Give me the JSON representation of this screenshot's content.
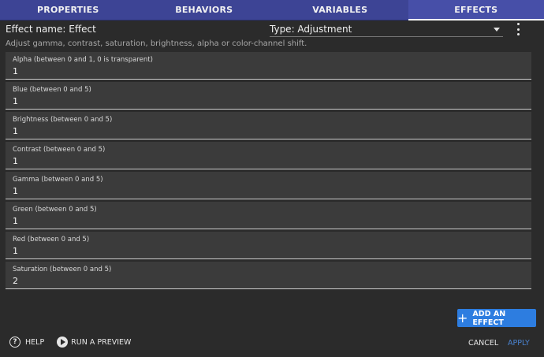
{
  "tabs": [
    {
      "label": "PROPERTIES"
    },
    {
      "label": "BEHAVIORS"
    },
    {
      "label": "VARIABLES"
    },
    {
      "label": "EFFECTS"
    }
  ],
  "active_tab": "EFFECTS",
  "effect": {
    "name_text": "Effect name: Effect",
    "type_text": "Type: Adjustment",
    "description": "Adjust gamma, contrast, saturation, brightness, alpha or color-channel shift."
  },
  "fields": [
    {
      "label": "Alpha (between 0 and 1, 0 is transparent)",
      "value": "1"
    },
    {
      "label": "Blue (between 0 and 5)",
      "value": "1"
    },
    {
      "label": "Brightness (between 0 and 5)",
      "value": "1"
    },
    {
      "label": "Contrast (between 0 and 5)",
      "value": "1"
    },
    {
      "label": "Gamma (between 0 and 5)",
      "value": "1"
    },
    {
      "label": "Green (between 0 and 5)",
      "value": "1"
    },
    {
      "label": "Red (between 0 and 5)",
      "value": "1"
    },
    {
      "label": "Saturation (between 0 and 5)",
      "value": "2"
    }
  ],
  "actions": {
    "add_effect": "ADD AN EFFECT",
    "help": "HELP",
    "run_preview": "RUN A PREVIEW",
    "cancel": "CANCEL",
    "apply": "APPLY"
  },
  "icons": {
    "kebab": "more-vert-icon",
    "add": "plus-icon",
    "help": "help-circle-icon",
    "play": "play-circle-icon"
  },
  "colors": {
    "tab_bar": "#3d4495",
    "primary_button": "#2d7de0",
    "apply_text": "#4a82cf",
    "background": "#2b2b2b"
  }
}
